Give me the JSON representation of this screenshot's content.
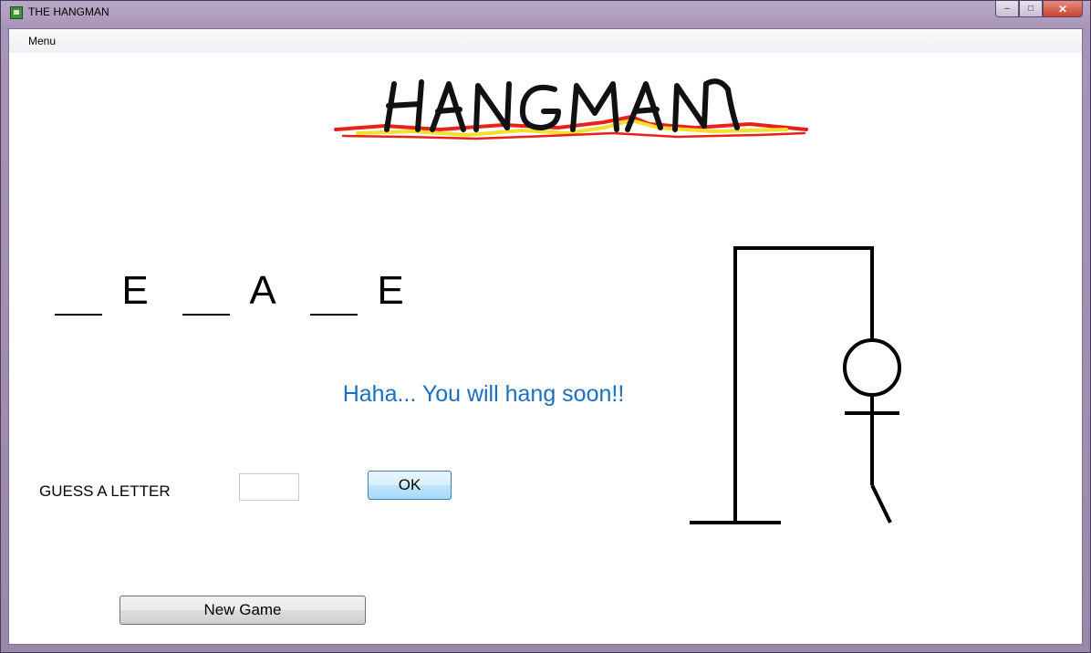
{
  "window": {
    "title": "THE HANGMAN",
    "controls": {
      "minimize": "–",
      "maximize": "□",
      "close": "✕"
    }
  },
  "menubar": {
    "items": [
      {
        "label": "Menu"
      }
    ]
  },
  "logo": {
    "text": "HANGMAN",
    "colors": {
      "ink": "#111111",
      "scribble_red": "#e8211a",
      "scribble_yellow": "#f4df2a"
    }
  },
  "word": {
    "slots": [
      {
        "letter": ""
      },
      {
        "letter": "E"
      },
      {
        "letter": ""
      },
      {
        "letter": "A"
      },
      {
        "letter": ""
      },
      {
        "letter": "E"
      }
    ]
  },
  "message": {
    "text": "Haha... You will hang soon!!",
    "color": "#1a6fc4"
  },
  "guess": {
    "label": "GUESS A LETTER",
    "value": "",
    "ok_label": "OK"
  },
  "new_game": {
    "label": "New Game"
  },
  "drawing": {
    "parts_shown": [
      "base",
      "pole",
      "beam",
      "rope",
      "head",
      "body",
      "arms",
      "leg"
    ],
    "stroke_color": "#000000"
  }
}
